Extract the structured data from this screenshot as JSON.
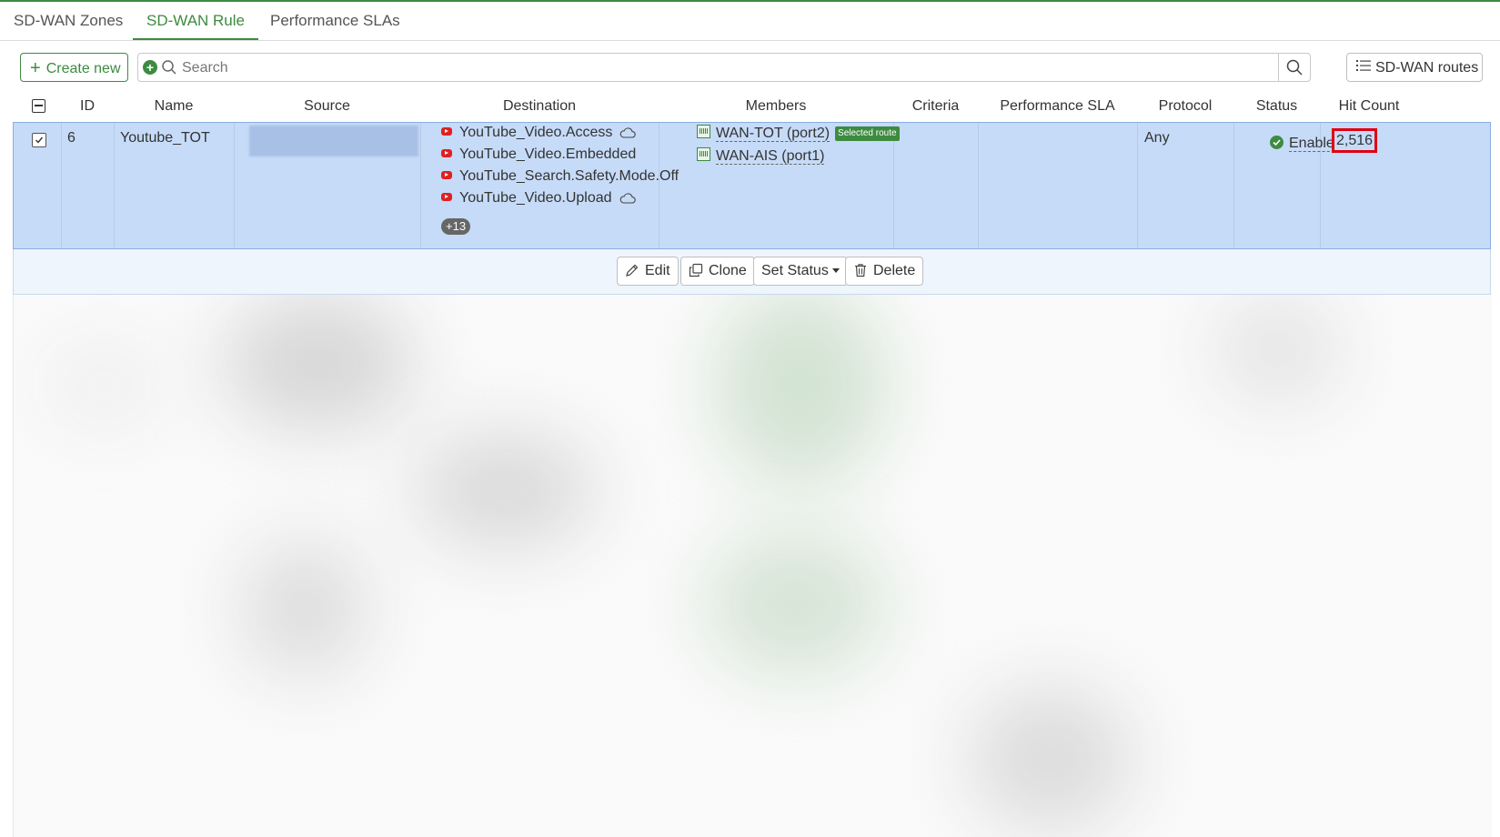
{
  "tabs": [
    {
      "label": "SD-WAN Zones",
      "active": false
    },
    {
      "label": "SD-WAN Rule",
      "active": true
    },
    {
      "label": "Performance SLAs",
      "active": false
    }
  ],
  "toolbar": {
    "create_new_label": "Create new",
    "search_placeholder": "Search",
    "sdwan_routes_label": "SD-WAN routes"
  },
  "table": {
    "columns": [
      "ID",
      "Name",
      "Source",
      "Destination",
      "Members",
      "Criteria",
      "Performance SLA",
      "Protocol",
      "Status",
      "Hit Count"
    ],
    "rows": [
      {
        "id": "6",
        "name": "Youtube_TOT",
        "destination": [
          {
            "label": "YouTube_Video.Access",
            "cloud": true
          },
          {
            "label": "YouTube_Video.Embedded",
            "cloud": false
          },
          {
            "label": "YouTube_Search.Safety.Mode.Off",
            "cloud": false
          },
          {
            "label": "YouTube_Video.Upload",
            "cloud": true
          }
        ],
        "destination_more": "+13",
        "members": [
          {
            "label": "WAN-TOT (port2)",
            "badge": "Selected route"
          },
          {
            "label": "WAN-AIS (port1)",
            "badge": ""
          }
        ],
        "criteria": "",
        "performance_sla": "",
        "protocol": "Any",
        "status": "Enable",
        "hit_count": "2,516",
        "selected": true
      }
    ]
  },
  "actions": {
    "edit": "Edit",
    "clone": "Clone",
    "set_status": "Set Status",
    "delete": "Delete"
  },
  "colors": {
    "accent": "#3d8b40",
    "selected_row": "#c6dbf7",
    "highlight_border": "#e00010",
    "youtube_red": "#e02020"
  }
}
